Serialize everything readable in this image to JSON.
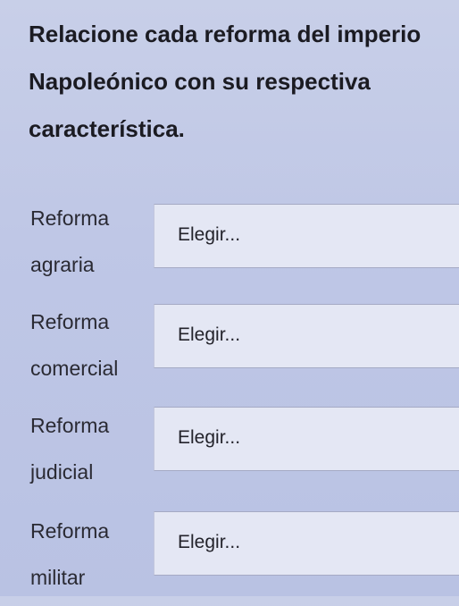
{
  "question": "Relacione cada reforma del imperio Napoleónico con su respectiva característica.",
  "rows": [
    {
      "label": "Reforma agraria",
      "select_value": "Elegir..."
    },
    {
      "label": "Reforma comercial",
      "select_value": "Elegir..."
    },
    {
      "label": "Reforma judicial",
      "select_value": "Elegir..."
    },
    {
      "label": "Reforma militar",
      "select_value": "Elegir..."
    }
  ]
}
